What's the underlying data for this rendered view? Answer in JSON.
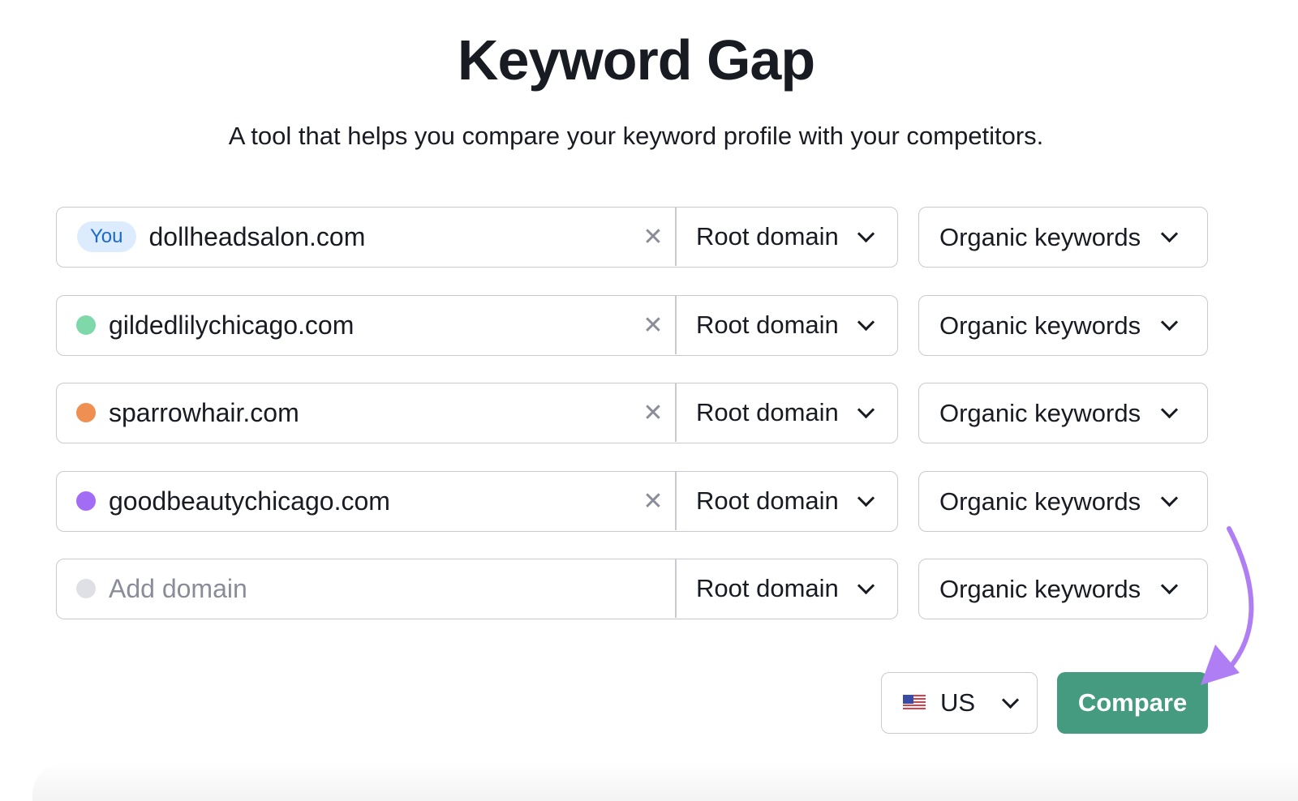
{
  "page": {
    "title": "Keyword Gap",
    "subtitle": "A tool that helps you compare your keyword profile with your competitors."
  },
  "rows": [
    {
      "badge": "You",
      "domain": "dollheadsalon.com",
      "dot_color": null,
      "clear_icon": "close-icon",
      "scope": "Root domain",
      "keyword_type": "Organic keywords"
    },
    {
      "badge": null,
      "domain": "gildedlilychicago.com",
      "dot_color": "#7ed8aa",
      "clear_icon": "close-icon",
      "scope": "Root domain",
      "keyword_type": "Organic keywords"
    },
    {
      "badge": null,
      "domain": "sparrowhair.com",
      "dot_color": "#ef8f52",
      "clear_icon": "close-icon",
      "scope": "Root domain",
      "keyword_type": "Organic keywords"
    },
    {
      "badge": null,
      "domain": "goodbeautychicago.com",
      "dot_color": "#a36cf4",
      "clear_icon": "close-icon",
      "scope": "Root domain",
      "keyword_type": "Organic keywords"
    },
    {
      "badge": null,
      "placeholder": "Add domain",
      "dot_color": "#dfe0e6",
      "scope": "Root domain",
      "keyword_type": "Organic keywords"
    }
  ],
  "footer": {
    "country": "US",
    "country_icon": "us-flag-icon",
    "compare_label": "Compare"
  },
  "colors": {
    "compare_button": "#459b80",
    "you_badge_bg": "#dcebfd",
    "you_badge_text": "#1a6bcc",
    "annotation_arrow": "#b07ef4"
  }
}
